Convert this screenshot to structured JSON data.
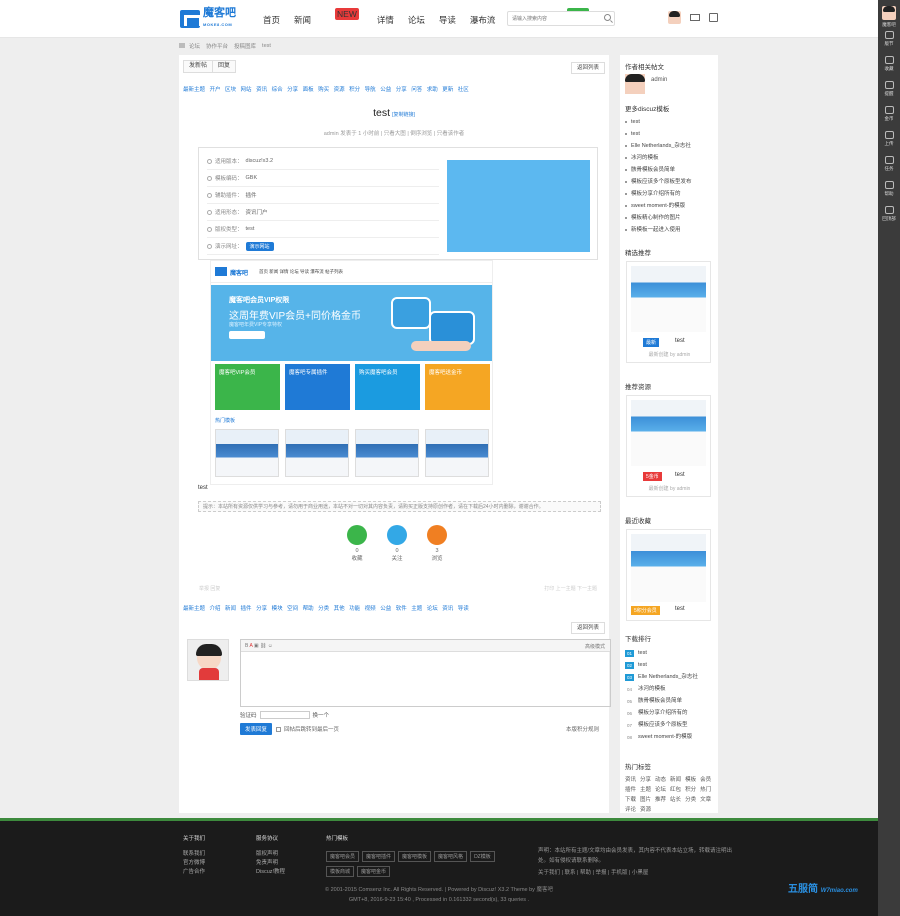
{
  "header": {
    "logo_text": "魔客吧",
    "logo_sub": "MOKE8.COM",
    "nav": [
      {
        "label": "首页"
      },
      {
        "label": "新闻",
        "badge": "NEW",
        "badge_color": "#e83a3a"
      },
      {
        "label": "详情"
      },
      {
        "label": "论坛"
      },
      {
        "label": "导读"
      },
      {
        "label": "瀑布流"
      },
      {
        "label": "帖子列表",
        "badge": "HOT",
        "badge_color": "#3bb54a"
      }
    ],
    "search_placeholder": "请输入搜索内容",
    "colors": {
      "accent": "#1f7ad6",
      "footer_border": "#3d8a3d"
    }
  },
  "rightbar": {
    "items": [
      {
        "label": "魔客吧",
        "icon": "avatar"
      },
      {
        "label": "版节",
        "icon": "calendar-icon"
      },
      {
        "label": "收藏",
        "icon": "star-icon"
      },
      {
        "label": "提醒",
        "icon": "bell-icon"
      },
      {
        "label": "金币",
        "icon": "coin-icon"
      },
      {
        "label": "上传",
        "icon": "upload-icon"
      },
      {
        "label": "任务",
        "icon": "task-icon"
      },
      {
        "label": "帮助",
        "icon": "help-icon"
      },
      {
        "label": "回顶部",
        "icon": "top-icon"
      }
    ]
  },
  "breadcrumb": [
    "首页",
    "论坛",
    "协作平台",
    "投稿图库",
    "test"
  ],
  "toolbar": {
    "new_thread": "发新帖",
    "reply": "回复",
    "back_list": "返回列表"
  },
  "categories_top": [
    "最新主题",
    "开户",
    "区块",
    "网站",
    "资讯",
    "综合",
    "分享",
    "面板",
    "购买",
    "资源",
    "积分",
    "导航",
    "公益",
    "分享",
    "问答",
    "求助",
    "更新",
    "社区"
  ],
  "post": {
    "title": "test",
    "title_tag": "[复制链接]",
    "meta": "admin 发表于 1 小时前 | 只看大图 | 倒序浏览 | 只看该作者",
    "info_rows": [
      {
        "key": "适用版本：",
        "value": "discuz!x3.2"
      },
      {
        "key": "模板编码：",
        "value": "GBK"
      },
      {
        "key": "辅助插件：",
        "value": "插件"
      },
      {
        "key": "适用形态：",
        "value": "资讯门户"
      },
      {
        "key": "版权类型：",
        "value": "test"
      },
      {
        "key": "演示网址：",
        "value": "",
        "button": "演示网站"
      }
    ],
    "shot": {
      "banner_line1": "魔客吧会员VIP权限",
      "banner_line2": "这周年费VIP会员+同价格金币",
      "banner_line3": "魔客吧年费VIP专享特权",
      "cards": [
        {
          "text": "魔客吧VIP会员",
          "color": "#3bb54a"
        },
        {
          "text": "魔客吧专属插件",
          "color": "#1f7ad6"
        },
        {
          "text": "购买魔客吧会员",
          "color": "#1b9be0"
        },
        {
          "text": "魔客吧送金币",
          "color": "#f5a623"
        }
      ],
      "section_label": "热门模板"
    },
    "caption": "test",
    "notice": "提示：本站所有资源仅供学习与参考，请勿用于商业用途，本站不对一切对其内容负责，请购买正版支持原创作者，请在下载后24小时内删除，谢谢合作。",
    "actions": [
      {
        "label": "收藏",
        "count": "0",
        "color": "#3bb54a"
      },
      {
        "label": "关注",
        "count": "0",
        "color": "#33a8e6"
      },
      {
        "label": "浏览",
        "count": "3",
        "color": "#f07f22"
      }
    ],
    "bottom_links": "举报    回复",
    "bottom_right": "打印   上一主题   下一主题"
  },
  "categories_bottom": [
    "最新主题",
    "介绍",
    "新闻",
    "插件",
    "分享",
    "模块",
    "空间",
    "帮助",
    "分类",
    "其他",
    "功能",
    "视频",
    "公益",
    "软件",
    "主题",
    "论坛",
    "资讯",
    "导读"
  ],
  "reply": {
    "editor_tip": "高级模式",
    "verify_label": "验证码",
    "verify_change": "换一个",
    "submit": "发表回复",
    "checkbox": "回帖后跳转到最后一页",
    "rules": "本版积分规则"
  },
  "sidebar": {
    "author_title": "作者相关帖文",
    "author_name": "admin",
    "more_title": "更多discuz模板",
    "more_items": [
      "test",
      "test",
      "Elle Netherlands_杂志社",
      "冰河的模板",
      "骸骨模板会员简单",
      "模板应该多个原板型发布",
      "模板分享介绍所有的",
      "sweet moment-的模版",
      "模板精心制作的图片",
      "新模板一起进入使用"
    ],
    "hot_title": "精选推荐",
    "hot_card": {
      "tag": "最新",
      "tag_color": "#1f7ad6",
      "name": "test",
      "by": "最新创建 by admin"
    },
    "rec_title": "推荐资源",
    "rec_card": {
      "tag": "5金币",
      "tag_color": "#e83a3a",
      "name": "test",
      "by": "最新创建 by admin"
    },
    "recent_title": "最近收藏",
    "recent_card": {
      "tag": "5积分会员",
      "tag_color": "#f5a623",
      "name": "test"
    },
    "rank_title": "下载排行",
    "rank_items": [
      "test",
      "test",
      "Elle Netherlands_杂志社",
      "冰河的模板",
      "骸骨模板会员简单",
      "模板分享介绍所有的",
      "模板应该多个原板型",
      "sweet moment-的模版"
    ],
    "tags_title": "热门标签",
    "tags": [
      "资讯",
      "分享",
      "动态",
      "新闻",
      "模板",
      "会员",
      "插件",
      "主题",
      "论坛",
      "红包",
      "积分",
      "热门",
      "下载",
      "图片",
      "推荐",
      "站长",
      "分类",
      "文章",
      "评论",
      "资源"
    ]
  },
  "footer": {
    "col1_title": "关于我们",
    "col1": [
      "联系我们",
      "官方微博",
      "广告合作"
    ],
    "col2_title": "服务协议",
    "col2": [
      "版权声明",
      "免责声明",
      "Discuz!教程"
    ],
    "col3_title": "热门模板",
    "buttons": [
      "魔客吧会员",
      "魔客吧插件",
      "魔客吧模板",
      "魔客吧风格",
      "DZ模板",
      "模板商城",
      "魔客吧金币"
    ],
    "note": "声明：本站所有主题/文章均由会员发表，其内容不代表本站立场，转载请注明出处。如有侵权请联系删除。",
    "note2": "关于我们 | 联系 | 帮助 | 举报 | 手机版 | 小黑屋",
    "copy1": "© 2001-2015 Comsenz Inc. All Rights Reserved. | Powered by Discuz! X3.2 Theme by 魔客吧",
    "copy2": "GMT+8, 2016-9-23 15:40 , Processed in 0.161332 second(s), 33 queries .",
    "watermark": "五服简",
    "watermark_sub": "W7miao.com"
  }
}
